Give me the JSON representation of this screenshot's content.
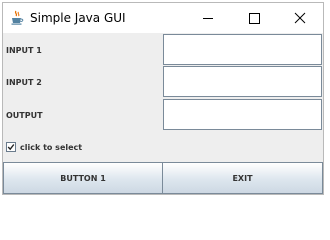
{
  "window": {
    "title": "Simple Java GUI"
  },
  "titlebar": {
    "icons": {
      "app": "java-cup-icon",
      "minimize": "minimize-icon",
      "maximize": "maximize-icon",
      "close": "close-icon"
    }
  },
  "form": {
    "input1": {
      "label": "INPUT 1",
      "value": ""
    },
    "input2": {
      "label": "INPUT 2",
      "value": ""
    },
    "output": {
      "label": "OUTPUT",
      "value": ""
    }
  },
  "checkbox": {
    "label": "click to select",
    "checked": true
  },
  "buttons": {
    "button1": "BUTTON 1",
    "exit": "EXIT"
  },
  "colors": {
    "content_bg": "#eeeeee",
    "field_border": "#7a8a99",
    "button_gradient_bottom": "#cdd8e3",
    "label_text": "#333333"
  }
}
